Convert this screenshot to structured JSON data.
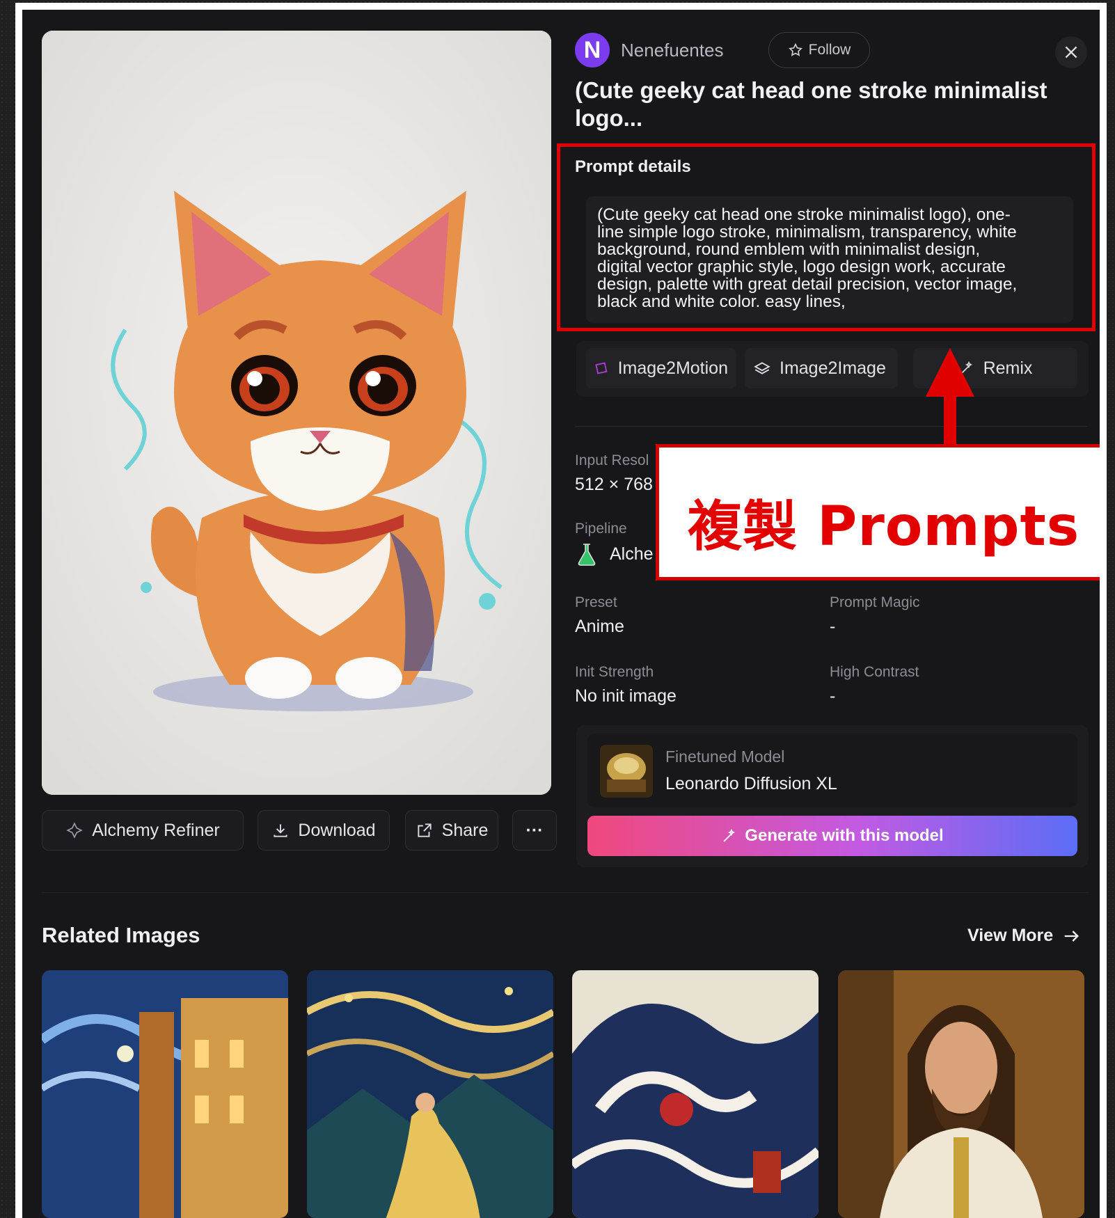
{
  "author": {
    "initial": "N",
    "name": "Nenefuentes",
    "follow_label": "Follow"
  },
  "title": "(Cute geeky cat head one stroke minimalist logo...",
  "prompt": {
    "label": "Prompt details",
    "lines": [
      "(Cute geeky cat head one stroke minimalist logo), one-",
      "line simple logo stroke, minimalism, transparency, white",
      "background, round emblem with minimalist design,",
      "digital vector graphic style, logo design work, accurate",
      "design, palette with great detail precision, vector image,",
      "black and white color. easy lines,"
    ]
  },
  "tools": {
    "image2motion": "Image2Motion",
    "image2image": "Image2Image",
    "remix": "Remix"
  },
  "meta": {
    "input_resolution_label": "Input Resol",
    "input_resolution_value": "512 × 768",
    "pipeline_label": "Pipeline",
    "pipeline_value": "Alche",
    "preset_label": "Preset",
    "preset_value": "Anime",
    "prompt_magic_label": "Prompt Magic",
    "prompt_magic_value": "-",
    "init_strength_label": "Init Strength",
    "init_strength_value": "No init image",
    "high_contrast_label": "High Contrast",
    "high_contrast_value": "-"
  },
  "model": {
    "label": "Finetuned Model",
    "name": "Leonardo Diffusion XL",
    "generate_label": "Generate with this model"
  },
  "image_actions": {
    "alchemy_refiner": "Alchemy Refiner",
    "download": "Download",
    "share": "Share",
    "more": "···"
  },
  "annotation": {
    "text": "複製 Prompts"
  },
  "related": {
    "title": "Related Images",
    "view_more": "View More"
  },
  "colors": {
    "accent_red": "#e00000",
    "avatar": "#7b3cf0",
    "gradient_start": "#f0487c",
    "gradient_end": "#5b6df6"
  }
}
